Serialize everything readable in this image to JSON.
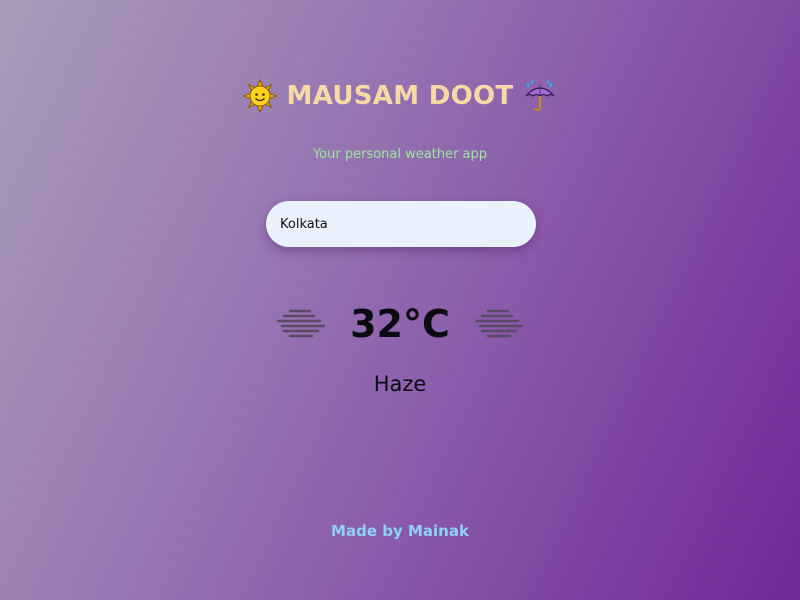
{
  "app": {
    "title": "MAUSAM DOOT",
    "subtitle": "Your personal weather app",
    "title_left_icon": "sun-face-icon",
    "title_right_icon": "umbrella-rain-icon"
  },
  "search": {
    "value": "Kolkata"
  },
  "weather": {
    "temperature": "32°C",
    "condition": "Haze",
    "icon": "haze-icon"
  },
  "footer": {
    "text": "Made by Mainak"
  },
  "colors": {
    "title": "#f7d9a8",
    "subtitle": "#9be89a",
    "footer": "#8ed3f7",
    "search_bg": "#ebf0fd"
  }
}
